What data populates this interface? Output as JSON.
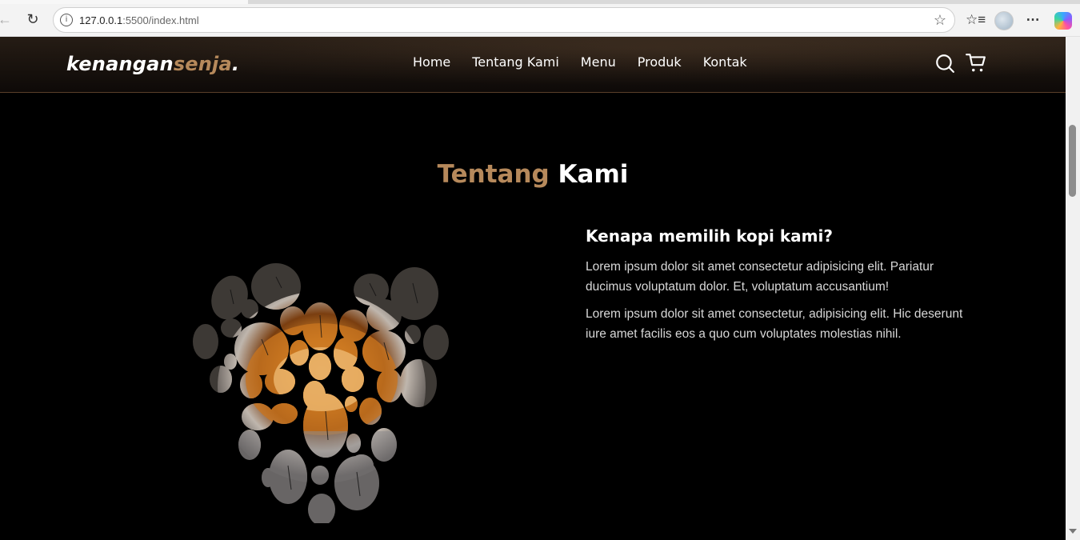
{
  "browser": {
    "url_host": "127.0.0.1",
    "url_path": ":5500/index.html"
  },
  "site": {
    "logo_main": "kenangan",
    "logo_accent": "senja",
    "logo_dot": ".",
    "nav": [
      "Home",
      "Tentang Kami",
      "Menu",
      "Produk",
      "Kontak"
    ]
  },
  "about": {
    "title_accent": "Tentang",
    "title_rest": "Kami",
    "heading": "Kenapa memilih kopi kami?",
    "paragraph_1": "Lorem ipsum dolor sit amet consectetur adipisicing elit. Pariatur ducimus voluptatum dolor. Et, voluptatum accusantium!",
    "paragraph_2": "Lorem ipsum dolor sit amet consectetur, adipisicing elit. Hic deserunt iure amet facilis eos a quo cum voluptates molestias nihil."
  },
  "colors": {
    "accent": "#b6895b",
    "background": "#000000"
  }
}
